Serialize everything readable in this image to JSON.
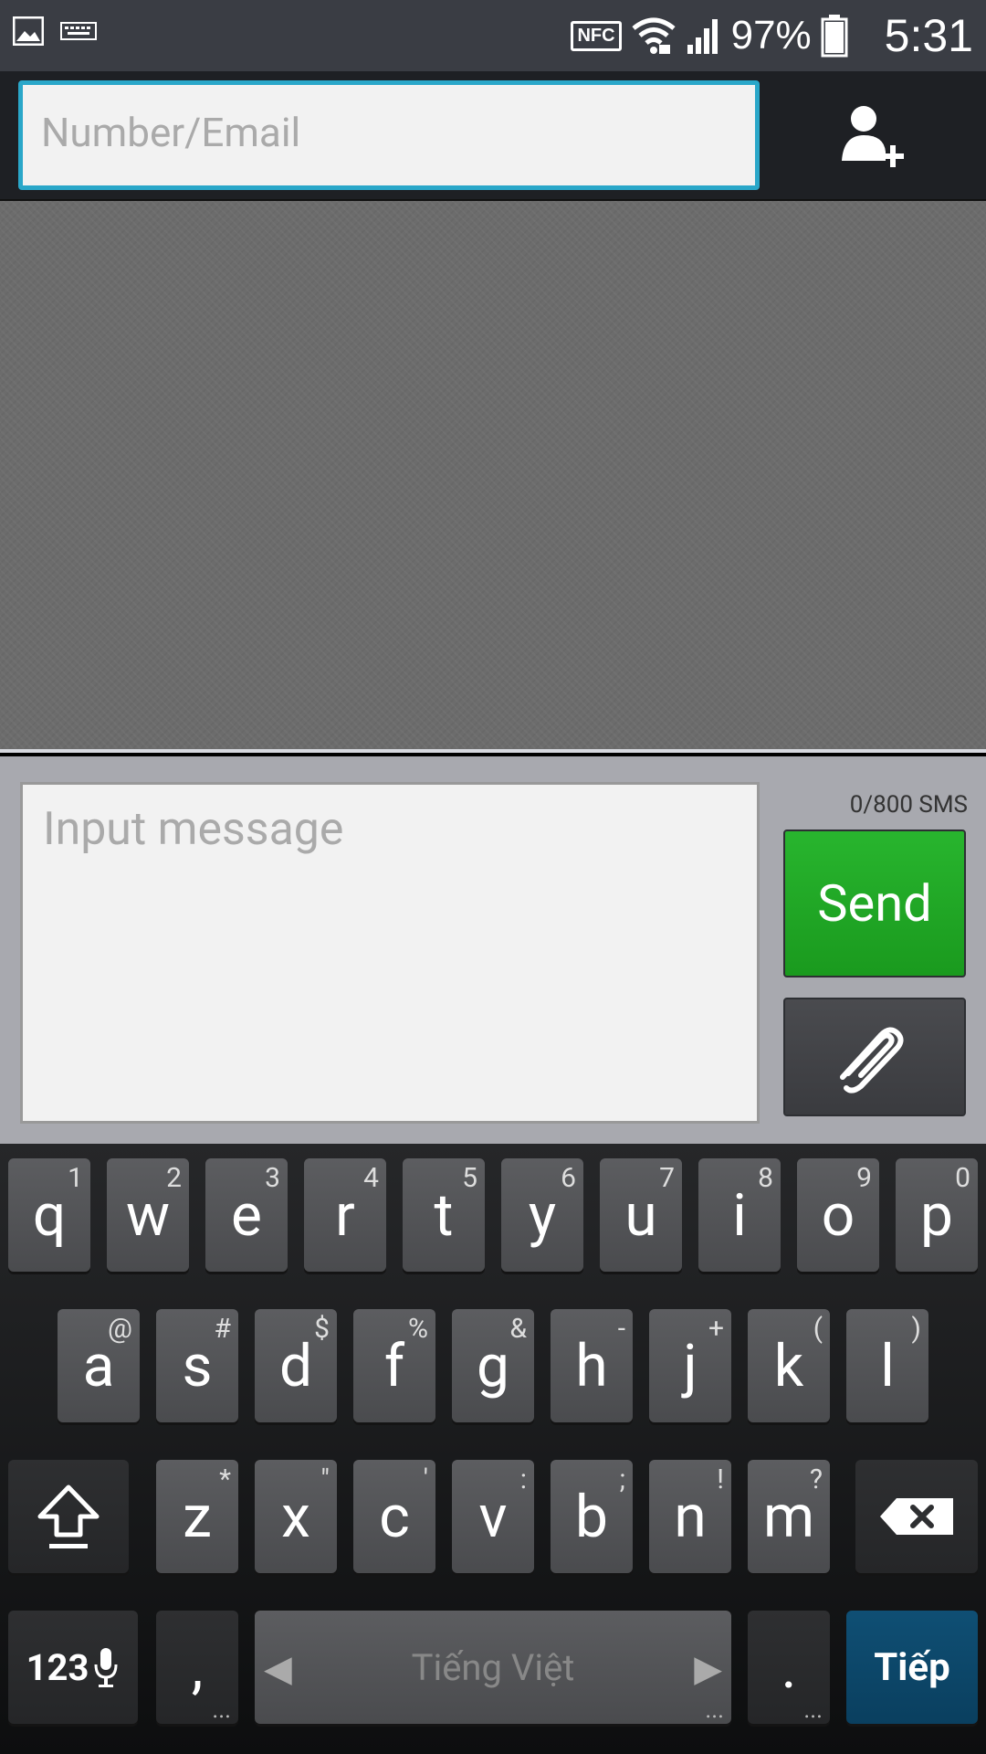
{
  "status_bar": {
    "battery": "97%",
    "time": "5:31",
    "nfc_label": "NFC",
    "icons": [
      "image-icon",
      "keyboard-icon",
      "nfc-icon",
      "wifi-icon",
      "signal-icon",
      "battery-icon"
    ]
  },
  "recipient": {
    "placeholder": "Number/Email"
  },
  "compose": {
    "placeholder": "Input message",
    "counter": "0/800  SMS",
    "send_label": "Send"
  },
  "keyboard": {
    "row1": [
      {
        "key": "q",
        "hint": "1"
      },
      {
        "key": "w",
        "hint": "2"
      },
      {
        "key": "e",
        "hint": "3"
      },
      {
        "key": "r",
        "hint": "4"
      },
      {
        "key": "t",
        "hint": "5"
      },
      {
        "key": "y",
        "hint": "6"
      },
      {
        "key": "u",
        "hint": "7"
      },
      {
        "key": "i",
        "hint": "8"
      },
      {
        "key": "o",
        "hint": "9"
      },
      {
        "key": "p",
        "hint": "0"
      }
    ],
    "row2": [
      {
        "key": "a",
        "hint": "@"
      },
      {
        "key": "s",
        "hint": "#"
      },
      {
        "key": "d",
        "hint": "$"
      },
      {
        "key": "f",
        "hint": "%"
      },
      {
        "key": "g",
        "hint": "&"
      },
      {
        "key": "h",
        "hint": "-"
      },
      {
        "key": "j",
        "hint": "+"
      },
      {
        "key": "k",
        "hint": "("
      },
      {
        "key": "l",
        "hint": ")"
      }
    ],
    "row3": [
      {
        "key": "z",
        "hint": "*"
      },
      {
        "key": "x",
        "hint": "\""
      },
      {
        "key": "c",
        "hint": "'"
      },
      {
        "key": "v",
        "hint": ":"
      },
      {
        "key": "b",
        "hint": ";"
      },
      {
        "key": "n",
        "hint": "!"
      },
      {
        "key": "m",
        "hint": "?"
      }
    ],
    "num_label": "123",
    "comma": ",",
    "space_label": "Tiếng Việt",
    "period": ".",
    "enter_label": "Tiếp",
    "more_dots": "..."
  }
}
